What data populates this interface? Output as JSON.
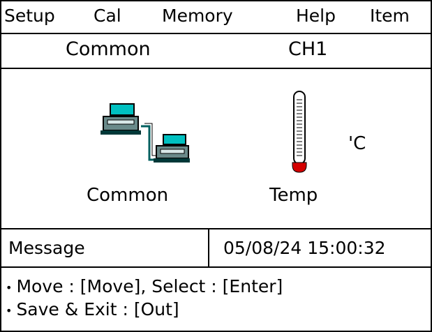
{
  "menu": {
    "items": [
      "Setup",
      "Cal",
      "Memory",
      "Help",
      "Item"
    ]
  },
  "header": {
    "left_title": "Common",
    "right_title": "CH1"
  },
  "main": {
    "common_label": "Common",
    "temp_label": "Temp",
    "unit": "'C",
    "icons": [
      "network-computers-icon",
      "thermometer-icon"
    ],
    "colors": {
      "screen": "#00c0c0",
      "thermo_bulb": "#d40000",
      "cable": "#006060"
    }
  },
  "status": {
    "message_label": "Message",
    "datetime": "05/08/24 15:00:32"
  },
  "help": {
    "bullet": "•",
    "line1": "Move : [Move], Select : [Enter]",
    "line2": "Save & Exit : [Out]"
  }
}
